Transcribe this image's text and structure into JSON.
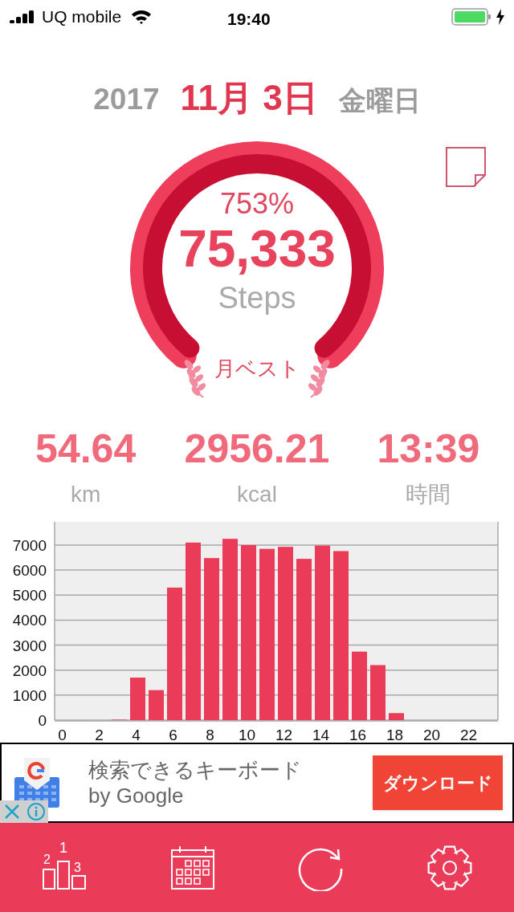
{
  "status_bar": {
    "carrier": "UQ mobile",
    "time": "19:40"
  },
  "date": {
    "year": "2017",
    "day": "11月 3日",
    "weekday": "金曜日"
  },
  "summary": {
    "percent": "753%",
    "steps": "75,333",
    "unit": "Steps",
    "badge": "月ベスト"
  },
  "stats": [
    {
      "value": "54.64",
      "unit": "km"
    },
    {
      "value": "2956.21",
      "unit": "kcal"
    },
    {
      "value": "13:39",
      "unit": "時間"
    }
  ],
  "chart_data": {
    "type": "bar",
    "x": [
      0,
      1,
      2,
      3,
      4,
      5,
      6,
      7,
      8,
      9,
      10,
      11,
      12,
      13,
      14,
      15,
      16,
      17,
      18,
      19,
      20,
      21,
      22,
      23
    ],
    "grid": true,
    "xlim": [
      -0.5,
      23.5
    ],
    "series": [
      {
        "color": "#ea3b58",
        "values": [
          0,
          0,
          0,
          20,
          1700,
          1200,
          5300,
          7100,
          6480,
          7250,
          7000,
          6850,
          6930,
          6450,
          6980,
          6760,
          2740,
          2200,
          280,
          0,
          0,
          0,
          0,
          0
        ]
      }
    ],
    "ylim": [
      0,
      7930
    ],
    "yticks": [
      0,
      1000,
      2000,
      3000,
      4000,
      5000,
      6000,
      7000
    ],
    "xticks": [
      0,
      2,
      4,
      6,
      8,
      10,
      12,
      14,
      16,
      18,
      20,
      22
    ]
  },
  "ad": {
    "title": "検索できるキーボード",
    "subtitle": "by Google",
    "button": "ダウンロード"
  },
  "nav": [
    {
      "kind": "ranking",
      "labels": [
        "1",
        "2",
        "3"
      ]
    },
    {
      "kind": "calendar"
    },
    {
      "kind": "refresh"
    },
    {
      "kind": "settings"
    }
  ]
}
